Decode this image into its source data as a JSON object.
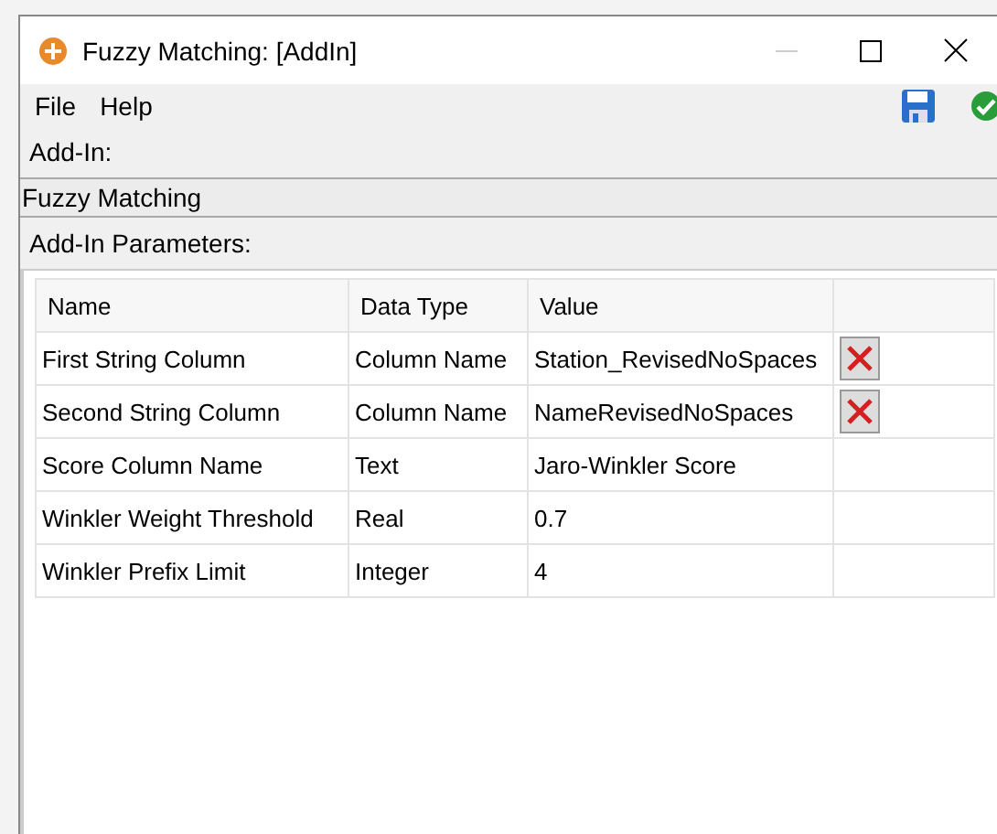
{
  "window": {
    "title": "Fuzzy Matching: [AddIn]"
  },
  "menu": [
    "File",
    "Help"
  ],
  "addin_label": "Add-In:",
  "addin_name": "Fuzzy Matching",
  "parameters_label": "Add-In Parameters:",
  "table": {
    "columns": [
      "Name",
      "Data Type",
      "Value"
    ],
    "rows": [
      {
        "name": "First String Column",
        "data_type": "Column Name",
        "value": "Station_RevisedNoSpaces",
        "removable": true
      },
      {
        "name": "Second String Column",
        "data_type": "Column Name",
        "value": "NameRevisedNoSpaces",
        "removable": true
      },
      {
        "name": "Score Column Name",
        "data_type": "Text",
        "value": "Jaro-Winkler Score",
        "removable": false
      },
      {
        "name": "Winkler Weight Threshold",
        "data_type": "Real",
        "value": "0.7",
        "removable": false
      },
      {
        "name": "Winkler Prefix Limit",
        "data_type": "Integer",
        "value": "4",
        "removable": false
      }
    ]
  }
}
